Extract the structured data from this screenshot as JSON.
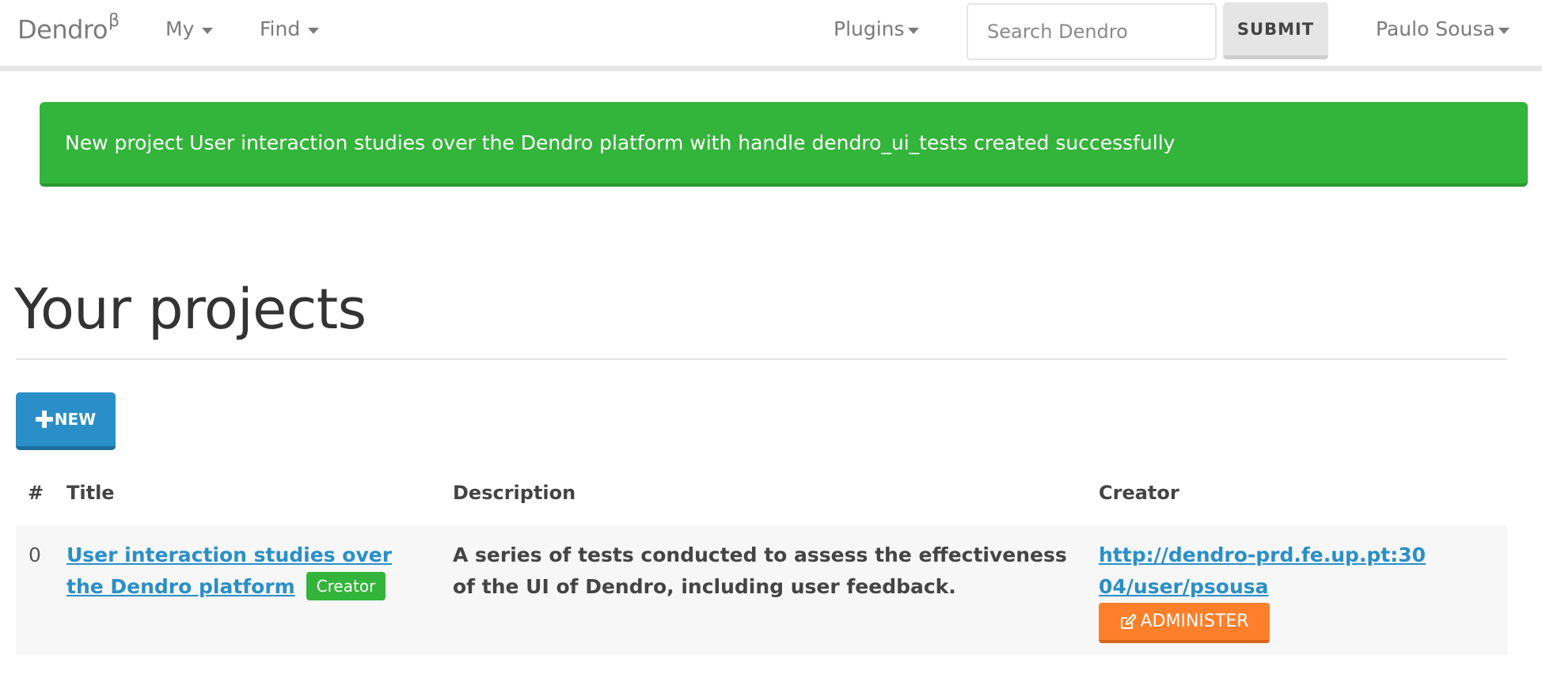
{
  "navbar": {
    "brand": "Dendro",
    "brand_sup": "β",
    "my_label": "My",
    "find_label": "Find",
    "plugins_label": "Plugins",
    "search_placeholder": "Search Dendro",
    "submit_label": "SUBMIT",
    "user_label": "Paulo Sousa"
  },
  "alert": {
    "message": "New project User interaction studies over the Dendro platform with handle dendro_ui_tests created successfully",
    "color": "#33b43a"
  },
  "page": {
    "title": "Your projects",
    "new_button_label": "NEW"
  },
  "table": {
    "headers": {
      "index": "#",
      "title": "Title",
      "description": "Description",
      "creator": "Creator"
    },
    "rows": [
      {
        "index": "0",
        "title": "User interaction studies over the Dendro platform",
        "badge": "Creator",
        "description": "A series of tests conducted to assess the effectiveness of the UI of Dendro, including user feedback.",
        "creator_url": "http://dendro-prd.fe.up.pt:3004/user/psousa",
        "admin_label": "ADMINISTER"
      }
    ]
  },
  "colors": {
    "primary": "#2a8fc7",
    "success": "#33b43a",
    "warning": "#ff7f2a"
  },
  "icons": {
    "new_button": "plus-icon",
    "administer_button": "edit-icon",
    "dropdown": "caret-down-icon"
  }
}
